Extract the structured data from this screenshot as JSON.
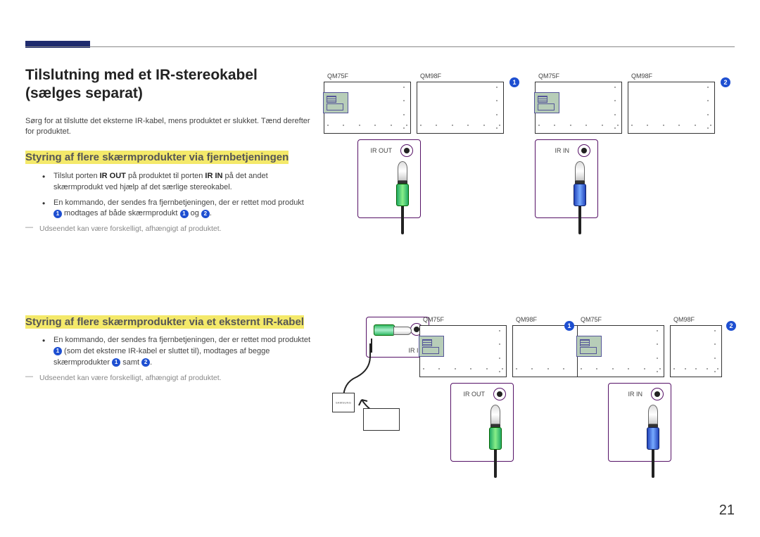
{
  "accent": "#1e2b6e",
  "page_number": "21",
  "section1": {
    "title": "Tilslutning med et IR-stereokabel (sælges separat)",
    "intro": "Sørg for at tilslutte det eksterne IR-kabel, mens produktet er slukket. Tænd derefter for produktet.",
    "sub1_title": "Styring af flere skærmprodukter via fjernbetjeningen",
    "bullet1_pre": "Tilslut porten ",
    "bullet1_b1": "IR OUT",
    "bullet1_mid": " på produktet til porten ",
    "bullet1_b2": "IR IN",
    "bullet1_post": " på det andet skærmprodukt ved hjælp af det særlige stereokabel.",
    "bullet2_pre": "En kommando, der sendes fra fjernbetjeningen, der er rettet mod produkt ",
    "bullet2_mid": " modtages af både skærmprodukt ",
    "bullet2_og": " og ",
    "bullet2_end": ".",
    "note": "Udseendet kan være forskelligt, afhængigt af produktet."
  },
  "section2": {
    "title": "Styring af flere skærmprodukter via et eksternt IR-kabel",
    "bullet_pre": "En kommando, der sendes fra fjernbetjeningen, der er rettet mod produktet ",
    "bullet_mid1": " (som det eksterne IR-kabel er sluttet til), modtages af begge skærmprodukter ",
    "bullet_mid2": " samt ",
    "bullet_end": ".",
    "note": "Udseendet kan være forskelligt, afhængigt af produktet."
  },
  "diagram": {
    "model_a": "QM75F",
    "model_b": "QM98F",
    "ir_out": "IR OUT",
    "ir_in": "IR IN",
    "badge1": "1",
    "badge2": "2"
  }
}
